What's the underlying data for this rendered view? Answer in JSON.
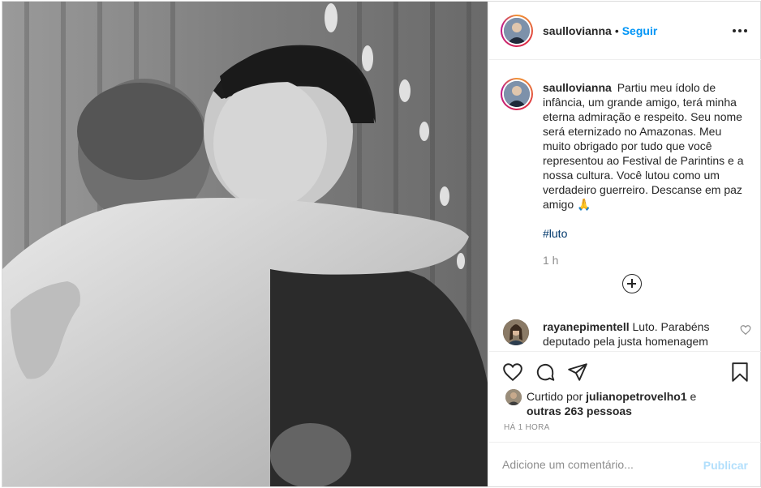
{
  "post": {
    "author": "saullovianna",
    "separator": "•",
    "follow_label": "Seguir",
    "more_icon": "more-horizontal-icon",
    "caption": "Partiu meu ídolo de infância, um grande amigo, terá minha eterna admiração e respeito. Seu nome será eternizado no Amazonas. Meu muito obrigado por tudo que você representou ao Festival de Parintins e a nossa cultura. Você lutou como um verdadeiro guerreiro. Descanse em paz amigo 🙏",
    "hashtag": "#luto",
    "caption_time": "1 h",
    "load_more_icon": "plus-circle-icon",
    "comment": {
      "author": "rayanepimentell",
      "text": "Luto. Parabéns deputado pela justa homenagem",
      "like_icon": "heart-outline-icon"
    },
    "actions": [
      "heart-icon",
      "comment-icon",
      "share-icon",
      "bookmark-icon"
    ],
    "likes": {
      "prefix": "Curtido por",
      "user": "julianopetrovelho1",
      "conjunction": "e",
      "others": "outras 263 pessoas"
    },
    "timestamp": "HÁ 1 HORA",
    "comment_placeholder": "Adicione um comentário...",
    "publish_label": "Publicar"
  },
  "colors": {
    "link_blue": "#0095f6",
    "hashtag_blue": "#00376b",
    "muted_gray": "#8e8e8e",
    "publish_disabled": "#b2dffc",
    "border": "#dbdbdb"
  }
}
